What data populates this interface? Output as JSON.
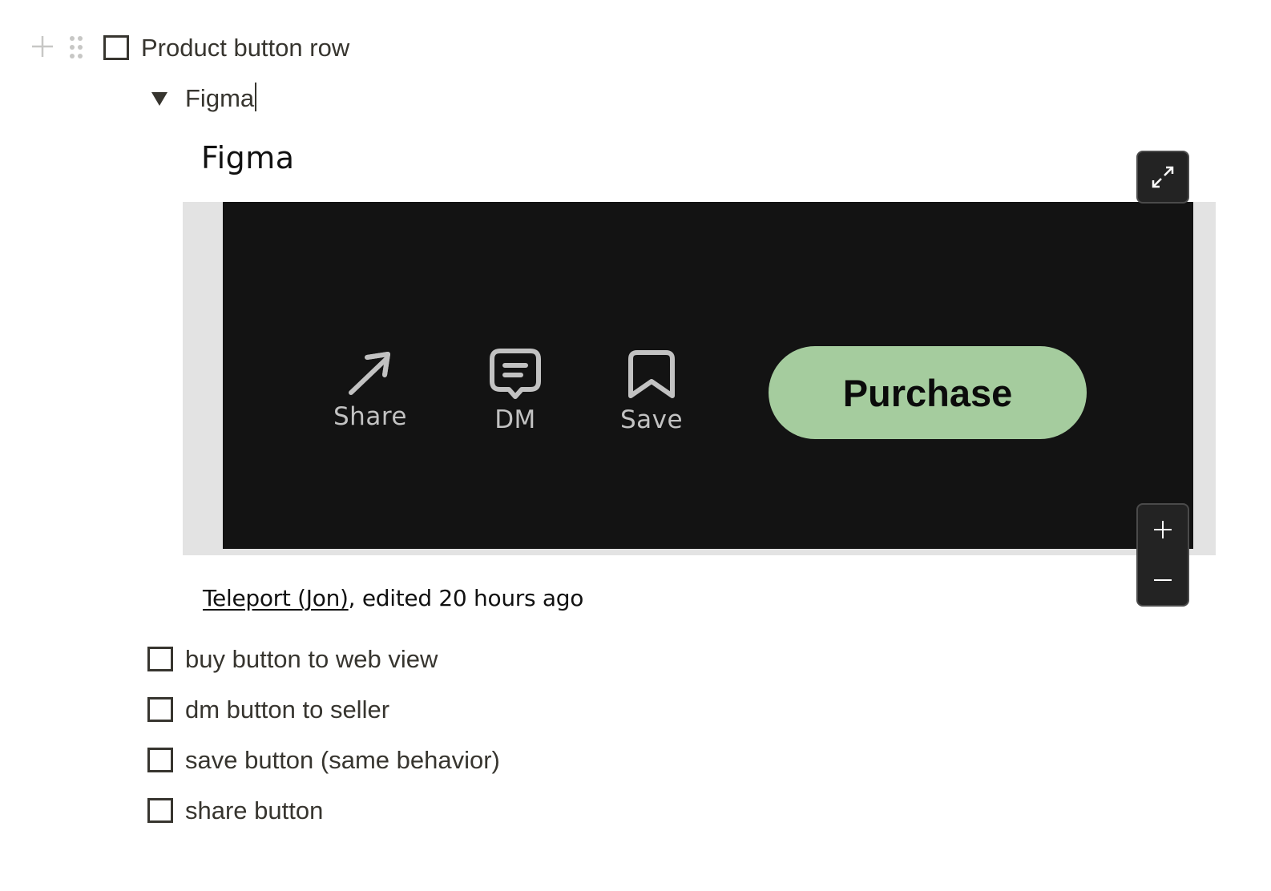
{
  "parent_todo": {
    "label": "Product button row",
    "checked": false,
    "block_add_icon": "plus-icon",
    "block_drag_icon": "drag-handle-icon"
  },
  "toggle": {
    "label": "Figma",
    "expanded": true,
    "icon": "triangle-down-icon"
  },
  "embed": {
    "title": "Figma",
    "fullscreen_icon": "expand-arrows-icon",
    "zoom_in_icon": "plus-icon",
    "zoom_out_icon": "minus-icon",
    "frame_bg": "#e3e3e3",
    "canvas_bg": "#131313",
    "design": {
      "actions": [
        {
          "label": "Share",
          "icon": "arrow-up-right-icon"
        },
        {
          "label": "DM",
          "icon": "chat-bubble-icon"
        },
        {
          "label": "Save",
          "icon": "bookmark-icon"
        }
      ],
      "primary_button": {
        "label": "Purchase",
        "color": "#a5cc9e"
      }
    },
    "caption": {
      "author": "Teleport (Jon)",
      "suffix": ", edited 20 hours ago"
    }
  },
  "todos": [
    {
      "label": "buy button to web view",
      "checked": false
    },
    {
      "label": "dm button to seller",
      "checked": false
    },
    {
      "label": "save button (same behavior)",
      "checked": false
    },
    {
      "label": "share button",
      "checked": false
    }
  ]
}
